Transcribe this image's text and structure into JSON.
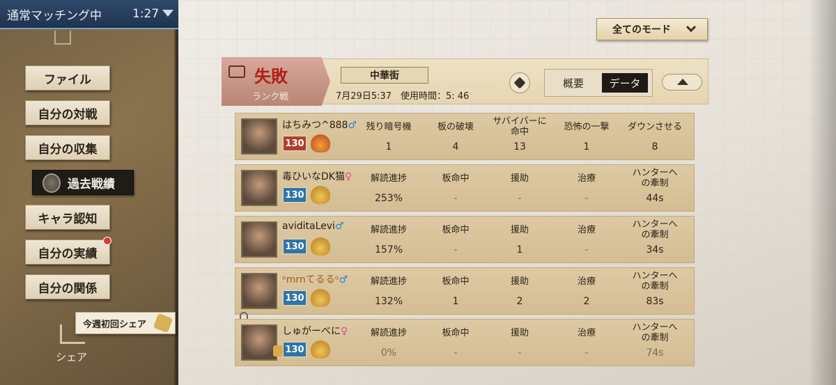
{
  "status_bar": {
    "label": "通常マッチング中",
    "time": "1:27"
  },
  "sidebar": {
    "items": [
      {
        "label": "ファイル"
      },
      {
        "label": "自分の対戦"
      },
      {
        "label": "自分の収集"
      },
      {
        "label": "過去戦績",
        "active": true
      },
      {
        "label": "キャラ認知"
      },
      {
        "label": "自分の実績",
        "notification": true
      },
      {
        "label": "自分の関係"
      }
    ],
    "share_tag": "今週初回シェア",
    "share_label": "シェア"
  },
  "mode_select": {
    "label": "全てのモード"
  },
  "match": {
    "result": "失敗",
    "mode": "ランク戦",
    "map": "中華街",
    "info": "7月29日5:37　使用時間：5: 46",
    "tabs": {
      "overview": "概要",
      "data": "データ"
    },
    "active_tab": "データ"
  },
  "hunter": {
    "name": "はちみつ^888",
    "gender": "♂",
    "level": "130",
    "stats": [
      {
        "header": "残り暗号機",
        "value": "1"
      },
      {
        "header": "板の破壊",
        "value": "4"
      },
      {
        "header": "サバイバーに命中",
        "value": "13"
      },
      {
        "header": "恐怖の一撃",
        "value": "1"
      },
      {
        "header": "ダウンさせる",
        "value": "8"
      }
    ]
  },
  "survivor_headers": [
    "解読進捗",
    "板命中",
    "援助",
    "治療",
    "ハンターへの牽制"
  ],
  "survivors": [
    {
      "name": "毒ひいなDK猫",
      "gender": "♀",
      "level": "130",
      "values": [
        "253%",
        "-",
        "-",
        "-",
        "44s"
      ]
    },
    {
      "name": "aviditaLevi",
      "gender": "♂",
      "level": "130",
      "values": [
        "157%",
        "-",
        "1",
        "-",
        "34s"
      ]
    },
    {
      "name": "ᵒmrnてるるᵒ",
      "gender": "♂",
      "level": "130",
      "values": [
        "132%",
        "1",
        "2",
        "2",
        "83s"
      ]
    },
    {
      "name": "しゅがーべに",
      "gender": "♀",
      "level": "130",
      "values": [
        "0%",
        "-",
        "-",
        "-",
        "74s"
      ]
    }
  ],
  "colors": {
    "result_red": "#b01f1a",
    "male_blue": "#2f7fd6",
    "female_pink": "#e04e86",
    "level_red": "#b0402d",
    "level_blue": "#2f74a8"
  }
}
